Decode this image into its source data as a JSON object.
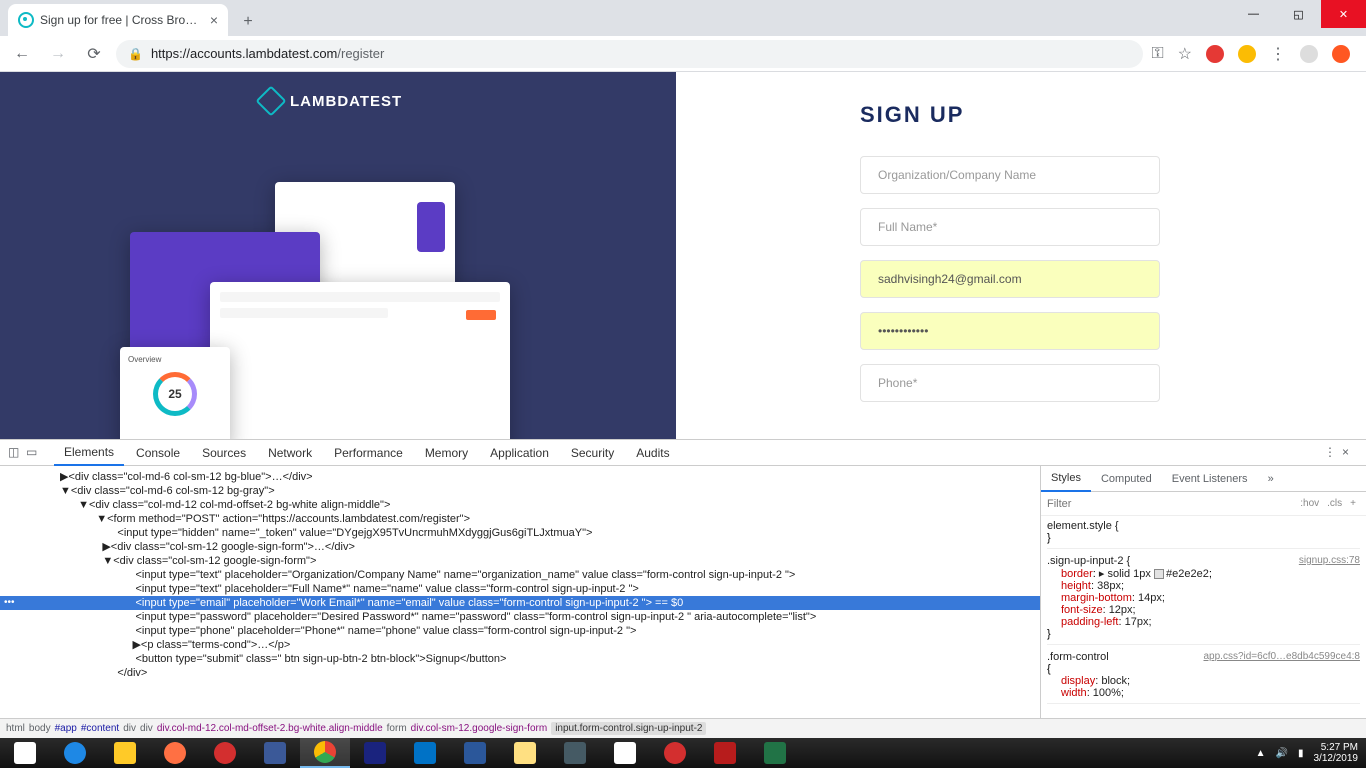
{
  "window": {
    "tab_title": "Sign up for free | Cross Browser T"
  },
  "url": {
    "host": "https://accounts.lambdatest.com",
    "path": "/register"
  },
  "brand": {
    "name": "LAMBDATEST"
  },
  "illustration": {
    "overview_label": "Overview",
    "donut_value": "25"
  },
  "form": {
    "title": "SIGN UP",
    "org_placeholder": "Organization/Company Name",
    "name_placeholder": "Full Name*",
    "email_placeholder": "Work Email*",
    "email_value": "sadhvisingh24@gmail.com",
    "password_placeholder": "Desired Password*",
    "password_value": "••••••••••••",
    "phone_placeholder": "Phone*"
  },
  "devtools": {
    "tabs": [
      "Elements",
      "Console",
      "Sources",
      "Network",
      "Performance",
      "Memory",
      "Application",
      "Security",
      "Audits"
    ],
    "styles_tabs": [
      "Styles",
      "Computed",
      "Event Listeners"
    ],
    "filter_placeholder": "Filter",
    "filter_hov": ":hov",
    "filter_cls": ".cls",
    "elements": {
      "l1": "▶<div class=\"col-md-6 col-sm-12 bg-blue\">…</div>",
      "l2": "▼<div class=\"col-md-6 col-sm-12 bg-gray\">",
      "l3": "  ▼<div class=\"col-md-12 col-md-offset-2 bg-white align-middle\">",
      "l4": "    ▼<form method=\"POST\" action=\"https://accounts.lambdatest.com/register\">",
      "l5": "       <input type=\"hidden\" name=\"_token\" value=\"DYgejgX95TvUncrmuhMXdyggjGus6giTLJxtmuaY\">",
      "l6": "      ▶<div class=\"col-sm-12 google-sign-form\">…</div>",
      "l7": "      ▼<div class=\"col-sm-12 google-sign-form\">",
      "l8": "         <input type=\"text\" placeholder=\"Organization/Company Name\" name=\"organization_name\" value class=\"form-control sign-up-input-2 \">",
      "l9": "         <input type=\"text\" placeholder=\"Full Name*\" name=\"name\" value class=\"form-control sign-up-input-2 \">",
      "l10": "         <input type=\"email\" placeholder=\"Work Email*\" name=\"email\" value class=\"form-control sign-up-input-2 \"> == $0",
      "l11": "         <input type=\"password\" placeholder=\"Desired Password*\" name=\"password\" class=\"form-control sign-up-input-2 \" aria-autocomplete=\"list\">",
      "l12": "         <input type=\"phone\" placeholder=\"Phone*\" name=\"phone\" value class=\"form-control sign-up-input-2 \">",
      "l13": "        ▶<p class=\"terms-cond\">…</p>",
      "l14": "         <button type=\"submit\" class=\" btn sign-up-btn-2 btn-block\">Signup</button>",
      "l15": "       </div>"
    },
    "rules": {
      "r1_sel": "element.style {",
      "r1_close": "}",
      "r2_sel": ".sign-up-input-2 {",
      "r2_src": "signup.css:78",
      "r2_p1n": "border",
      "r2_p1v": "▸ solid 1px ",
      "r2_p1c": "#e2e2e2",
      "r2_p1end": ";",
      "r2_p2n": "height",
      "r2_p2v": ": 38px;",
      "r2_p3n": "margin-bottom",
      "r2_p3v": ": 14px;",
      "r2_p4n": "font-size",
      "r2_p4v": ": 12px;",
      "r2_p5n": "padding-left",
      "r2_p5v": ": 17px;",
      "r2_close": "}",
      "r3_sel": ".form-control",
      "r3_src": "app.css?id=6cf0…e8db4c599ce4:8",
      "r3_open": "{",
      "r3_p1n": "display",
      "r3_p1v": ": block;",
      "r3_p2n": "width",
      "r3_p2v": ": 100%;"
    },
    "breadcrumb": [
      "html",
      "body",
      "#app",
      "#content",
      "div",
      "div",
      "div.col-md-12.col-md-offset-2.bg-white.align-middle",
      "form",
      "div.col-sm-12.google-sign-form",
      "input.form-control.sign-up-input-2"
    ]
  },
  "systray": {
    "time": "5:27 PM",
    "date": "3/12/2019"
  }
}
